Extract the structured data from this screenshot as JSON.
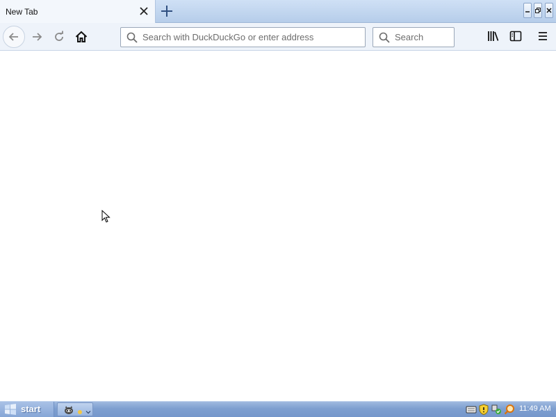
{
  "browser": {
    "tab": {
      "title": "New Tab",
      "close_icon": "close-icon"
    },
    "new_tab_icon": "plus-icon",
    "window_controls": [
      "minimize-icon",
      "restore-icon",
      "close-icon"
    ],
    "nav": {
      "back_icon": "arrow-left-icon",
      "forward_icon": "arrow-right-icon",
      "reload_icon": "reload-icon",
      "home_icon": "home-icon"
    },
    "address_bar": {
      "value": "",
      "placeholder": "Search with DuckDuckGo or enter address"
    },
    "search_bar": {
      "value": "",
      "placeholder": "Search"
    },
    "toolbar_icons": [
      "library-icon",
      "sidebar-icon",
      "hamburger-menu-icon"
    ]
  },
  "taskbar": {
    "start_label": "start",
    "clock": "11:49 AM",
    "tray_icons": [
      "keyboard-icon",
      "shield-icon",
      "network-icon",
      "search-icon"
    ]
  },
  "colors": {
    "tab_strip": "#b6cdea",
    "toolbar": "#eef3fa",
    "taskbar": "#7e9fd0",
    "content": "#ffffff"
  }
}
